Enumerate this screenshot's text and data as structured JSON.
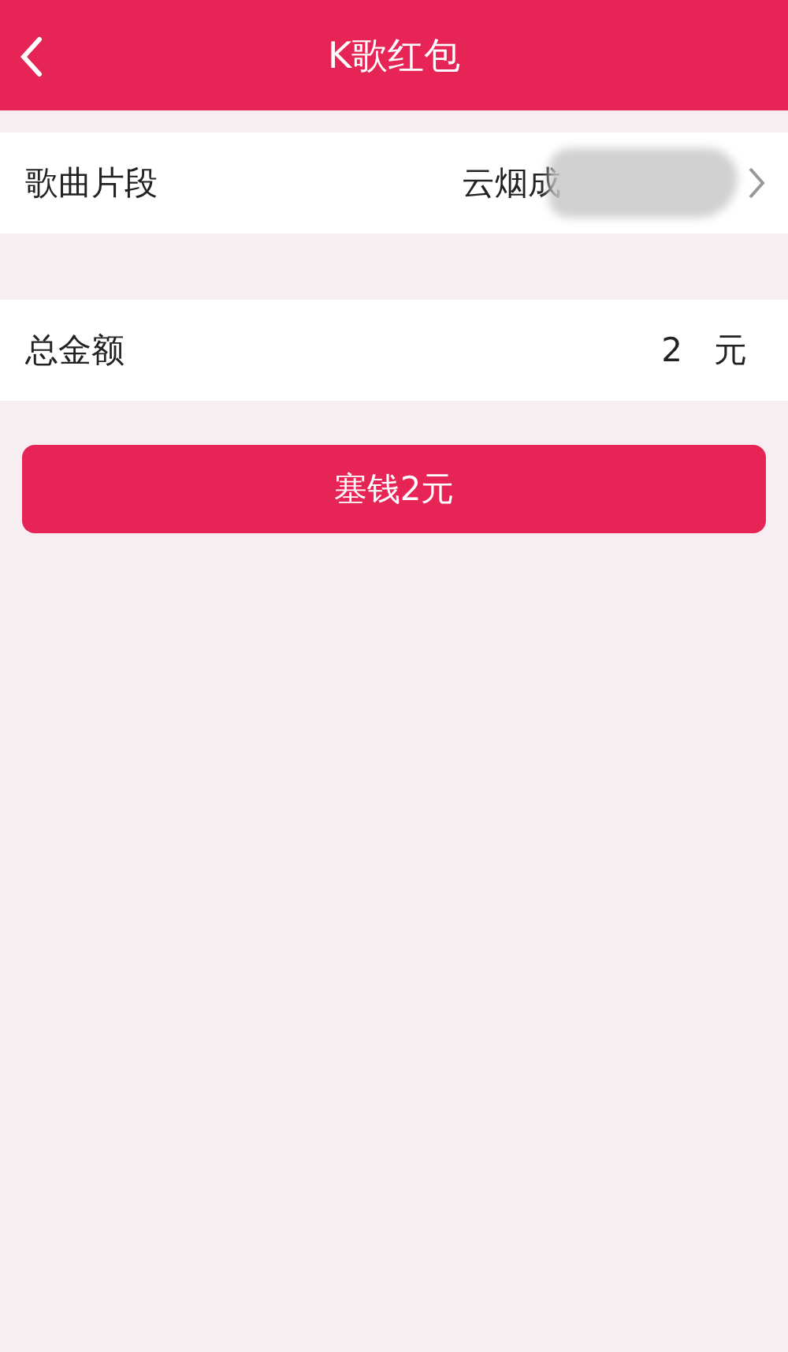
{
  "header": {
    "title": "K歌红包"
  },
  "song": {
    "label": "歌曲片段",
    "value": "云烟成",
    "redacted": true
  },
  "amount": {
    "label": "总金额",
    "value": "2",
    "unit": "元"
  },
  "button": {
    "label": "塞钱2元"
  }
}
